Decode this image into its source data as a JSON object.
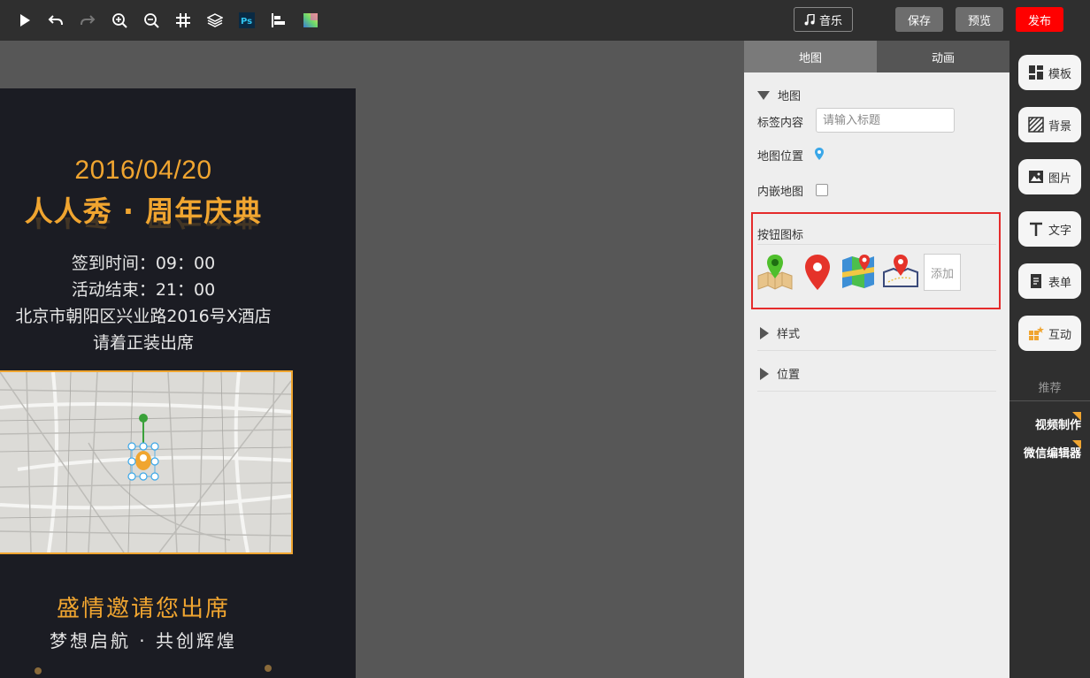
{
  "toolbar": {
    "icons": [
      "play-icon",
      "undo-icon",
      "redo-icon",
      "zoom-in-icon",
      "zoom-out-icon",
      "grid-icon",
      "layers-icon",
      "photoshop-icon",
      "align-icon",
      "color-icon"
    ],
    "music_label": "音乐",
    "save_label": "保存",
    "preview_label": "预览",
    "publish_label": "发布"
  },
  "invitation": {
    "date": "2016/04/20",
    "title": "人人秀 · 周年庆典",
    "checkin": "签到时间：09：00",
    "end": "活动结束：21：00",
    "address": "北京市朝阳区兴业路2016号X酒店",
    "dress": "请着正装出席",
    "invite": "盛情邀请您出席",
    "slogan": "梦想启航 · 共创辉煌"
  },
  "panel": {
    "tabs": [
      "地图",
      "动画"
    ],
    "section_map": "地图",
    "label_content": "标签内容",
    "label_placeholder": "请输入标题",
    "map_position": "地图位置",
    "embedded_map": "内嵌地图",
    "button_icons": "按钮图标",
    "add_label": "添加",
    "section_style": "样式",
    "section_position": "位置"
  },
  "sidebar": {
    "items": [
      "模板",
      "背景",
      "图片",
      "文字",
      "表单",
      "互动"
    ],
    "recommend": "推荐",
    "video": "视频制作",
    "wechat": "微信编辑器"
  },
  "colors": {
    "accent_gold": "#f0a530",
    "publish_red": "#ff0000",
    "highlight_red": "#e52b2b"
  }
}
